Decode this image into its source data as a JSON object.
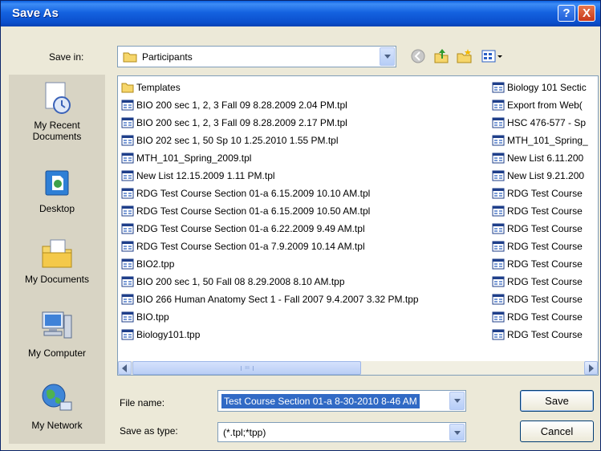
{
  "window": {
    "title": "Save As",
    "help_label": "?",
    "close_label": "X"
  },
  "save_in": {
    "label": "Save in:",
    "value": "Participants"
  },
  "places": [
    {
      "label": "My Recent Documents",
      "icon": "recent-documents-icon"
    },
    {
      "label": "Desktop",
      "icon": "desktop-icon"
    },
    {
      "label": "My Documents",
      "icon": "my-documents-icon"
    },
    {
      "label": "My Computer",
      "icon": "my-computer-icon"
    },
    {
      "label": "My Network",
      "icon": "my-network-icon"
    }
  ],
  "files_col1": [
    {
      "name": "Templates",
      "type": "folder"
    },
    {
      "name": "BIO 200 sec 1, 2, 3 Fall 09 8.28.2009 2.04 PM.tpl",
      "type": "file"
    },
    {
      "name": "BIO 200 sec 1, 2, 3 Fall 09 8.28.2009 2.17 PM.tpl",
      "type": "file"
    },
    {
      "name": "BIO 202 sec 1, 50 Sp 10 1.25.2010 1.55 PM.tpl",
      "type": "file"
    },
    {
      "name": "MTH_101_Spring_2009.tpl",
      "type": "file"
    },
    {
      "name": "New List 12.15.2009 1.11 PM.tpl",
      "type": "file"
    },
    {
      "name": "RDG Test Course Section 01-a 6.15.2009 10.10 AM.tpl",
      "type": "file"
    },
    {
      "name": "RDG Test Course Section 01-a 6.15.2009 10.50 AM.tpl",
      "type": "file"
    },
    {
      "name": "RDG Test Course Section 01-a 6.22.2009 9.49 AM.tpl",
      "type": "file"
    },
    {
      "name": "RDG Test Course Section 01-a 7.9.2009 10.14 AM.tpl",
      "type": "file"
    },
    {
      "name": "BIO2.tpp",
      "type": "file"
    },
    {
      "name": "BIO 200 sec 1, 50  Fall 08 8.29.2008 8.10 AM.tpp",
      "type": "file"
    },
    {
      "name": "BIO 266 Human Anatomy Sect 1 - Fall 2007 9.4.2007 3.32 PM.tpp",
      "type": "file"
    },
    {
      "name": "BIO.tpp",
      "type": "file"
    },
    {
      "name": "Biology101.tpp",
      "type": "file"
    }
  ],
  "files_col2": [
    {
      "name": "Biology 101 Sectic",
      "type": "file"
    },
    {
      "name": "Export from Web(",
      "type": "file"
    },
    {
      "name": "HSC 476-577 - Sp",
      "type": "file"
    },
    {
      "name": "MTH_101_Spring_",
      "type": "file"
    },
    {
      "name": "New List 6.11.200",
      "type": "file"
    },
    {
      "name": "New List 9.21.200",
      "type": "file"
    },
    {
      "name": "RDG Test Course",
      "type": "file"
    },
    {
      "name": "RDG Test Course",
      "type": "file"
    },
    {
      "name": "RDG Test Course",
      "type": "file"
    },
    {
      "name": "RDG Test Course",
      "type": "file"
    },
    {
      "name": "RDG Test Course",
      "type": "file"
    },
    {
      "name": "RDG Test Course",
      "type": "file"
    },
    {
      "name": "RDG Test Course",
      "type": "file"
    },
    {
      "name": "RDG Test Course",
      "type": "file"
    },
    {
      "name": "RDG Test Course",
      "type": "file"
    }
  ],
  "file_name": {
    "label": "File name:",
    "value": "Test Course Section 01-a 8-30-2010 8-46 AM"
  },
  "save_as_type": {
    "label": "Save as type:",
    "value": "(*.tpl;*tpp)"
  },
  "buttons": {
    "save": "Save",
    "cancel": "Cancel"
  },
  "scrollbar": {
    "grip": "III"
  },
  "colors": {
    "titlebar": "#0b4fcc",
    "selection": "#316ac5",
    "dialog_bg": "#ece9d8"
  }
}
